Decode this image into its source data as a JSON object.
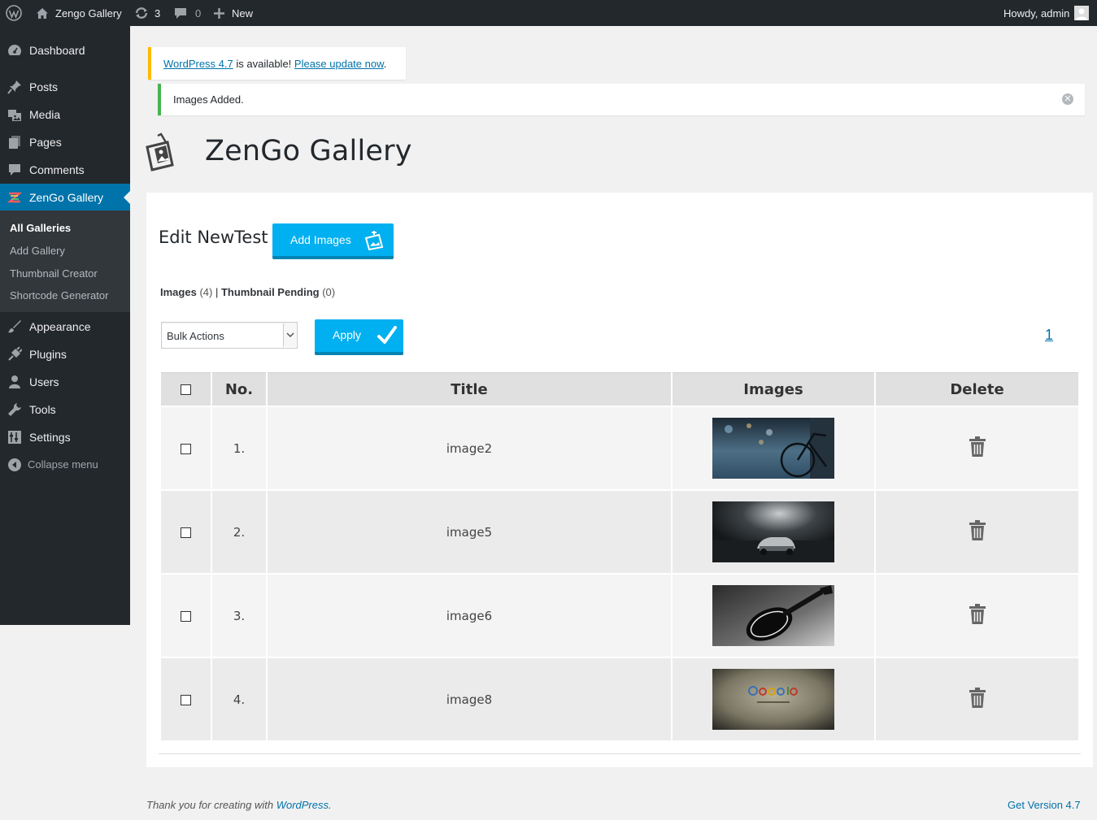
{
  "admin_bar": {
    "site_name": "Zengo Gallery",
    "updates_count": "3",
    "comments_count": "0",
    "new_label": "New",
    "greeting": "Howdy, admin"
  },
  "sidebar": {
    "items": [
      {
        "label": "Dashboard",
        "icon": "dashboard-icon"
      },
      {
        "label": "Posts",
        "icon": "pin-icon"
      },
      {
        "label": "Media",
        "icon": "media-icon"
      },
      {
        "label": "Pages",
        "icon": "pages-icon"
      },
      {
        "label": "Comments",
        "icon": "comment-icon"
      },
      {
        "label": "ZenGo Gallery",
        "icon": "zengo-icon"
      },
      {
        "label": "Appearance",
        "icon": "brush-icon"
      },
      {
        "label": "Plugins",
        "icon": "plugin-icon"
      },
      {
        "label": "Users",
        "icon": "user-icon"
      },
      {
        "label": "Tools",
        "icon": "wrench-icon"
      },
      {
        "label": "Settings",
        "icon": "settings-icon"
      }
    ],
    "submenu": [
      "All Galleries",
      "Add Gallery",
      "Thumbnail Creator",
      "Shortcode Generator"
    ],
    "collapse_label": "Collapse menu"
  },
  "notices": {
    "update_link": "WordPress 4.7",
    "update_text": " is available! ",
    "update_action": "Please update now",
    "update_period": ".",
    "success": "Images Added."
  },
  "page": {
    "title": "ZenGo Gallery",
    "edit_heading": "Edit NewTest",
    "add_images_label": "Add Images",
    "filter_images": "Images",
    "filter_images_count": "(4)",
    "filter_sep": "|",
    "filter_pending": "Thumbnail Pending",
    "filter_pending_count": "(0)",
    "bulk_actions": "Bulk Actions",
    "apply_label": "Apply",
    "page_number": "1"
  },
  "table": {
    "headers": [
      "No.",
      "Title",
      "Images",
      "Delete"
    ],
    "rows": [
      {
        "no": "1.",
        "title": "image2"
      },
      {
        "no": "2.",
        "title": "image5"
      },
      {
        "no": "3.",
        "title": "image6"
      },
      {
        "no": "4.",
        "title": "image8"
      }
    ]
  },
  "footer": {
    "thanks_prefix": "Thank you for creating with ",
    "thanks_link": "WordPress",
    "thanks_suffix": ".",
    "version": "Get Version 4.7"
  },
  "colors": {
    "admin_bar": "#23282d",
    "menu_active": "#0073aa",
    "button": "#00b0f0",
    "notice_success": "#46b450",
    "notice_warning": "#ffba00"
  }
}
